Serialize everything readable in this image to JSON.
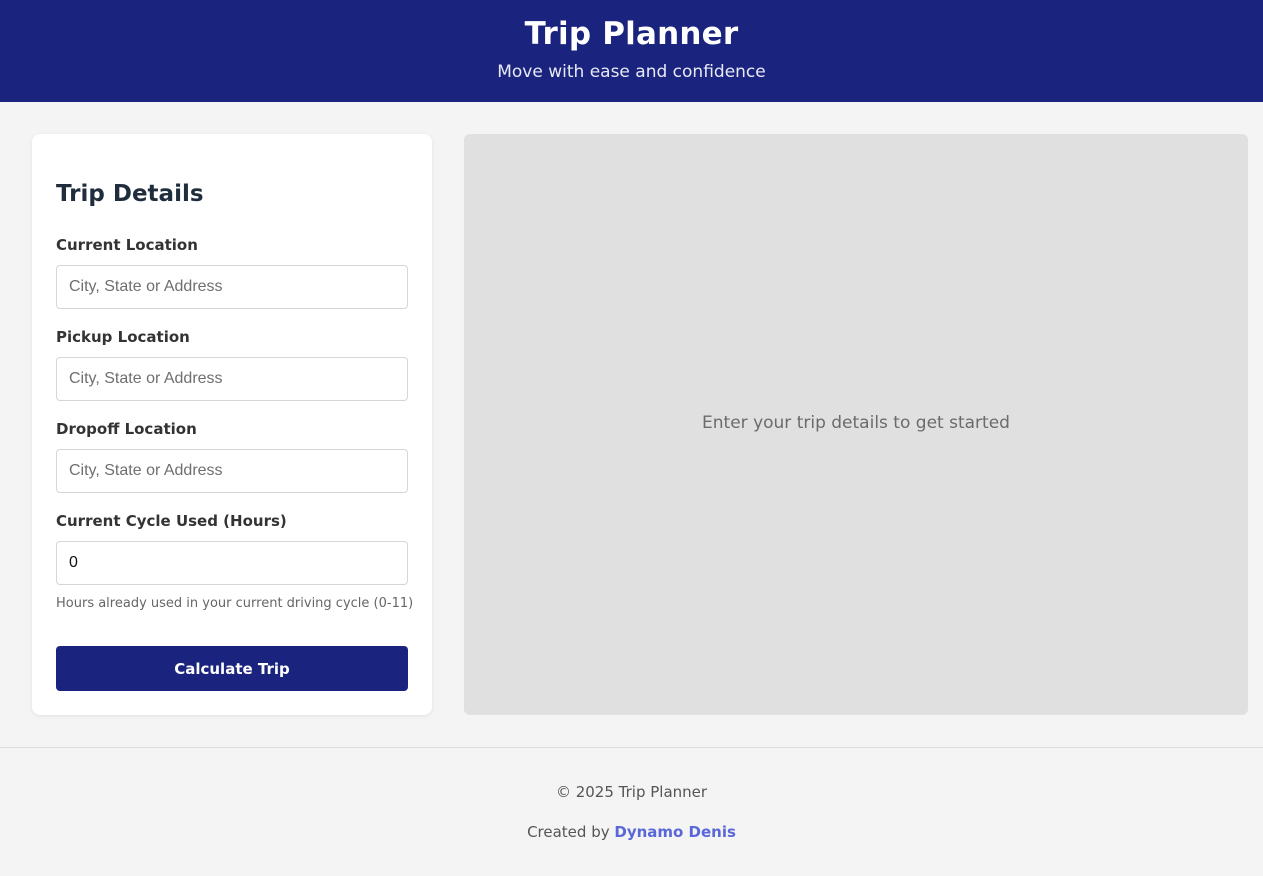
{
  "header": {
    "title": "Trip Planner",
    "subtitle": "Move with ease and confidence"
  },
  "form": {
    "heading": "Trip Details",
    "current_location": {
      "label": "Current Location",
      "placeholder": "City, State or Address",
      "value": ""
    },
    "pickup_location": {
      "label": "Pickup Location",
      "placeholder": "City, State or Address",
      "value": ""
    },
    "dropoff_location": {
      "label": "Dropoff Location",
      "placeholder": "City, State or Address",
      "value": ""
    },
    "cycle_used": {
      "label": "Current Cycle Used (Hours)",
      "value": "0",
      "hint": "Hours already used in your current driving cycle (0-11)"
    },
    "submit_label": "Calculate Trip"
  },
  "map_panel": {
    "placeholder": "Enter your trip details to get started"
  },
  "footer": {
    "copyright": "© 2025 Trip Planner",
    "credit_prefix": "Created by ",
    "author": "Dynamo Denis"
  },
  "colors": {
    "brand": "#1a237e",
    "link": "#5a67d8",
    "page_background": "#f4f4f4",
    "panel_background": "#e0e0e0"
  }
}
